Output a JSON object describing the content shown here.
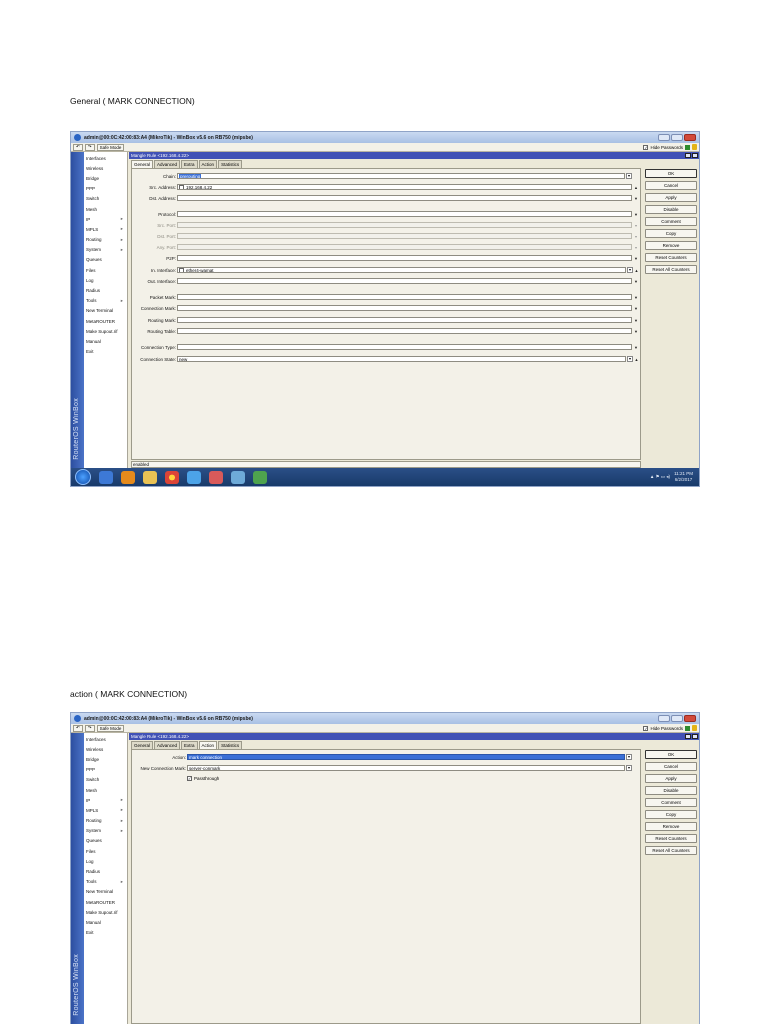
{
  "captions": {
    "first": "General ( MARK CONNECTION)",
    "second": "action ( MARK CONNECTION)"
  },
  "window": {
    "title": "admin@00:0C:42:00:83:A4 (MikroTik) - WinBox v5.6 on RB750 (mipsbe)",
    "safe_mode": "Safe Mode",
    "hide_passwords": "Hide Passwords",
    "side_label": "RouterOS WinBox"
  },
  "menu": [
    "Interfaces",
    "Wireless",
    "Bridge",
    "PPP",
    "Switch",
    "Mesh",
    "IP",
    "MPLS",
    "Routing",
    "System",
    "Queues",
    "Files",
    "Log",
    "Radius",
    "Tools",
    "New Terminal",
    "MetaROUTER",
    "Make Supout.rif",
    "Manual",
    "Exit"
  ],
  "menu_arrow": "▸",
  "dialog": {
    "title": "Mangle Rule <192.168.4.22>",
    "tabs": [
      "General",
      "Advanced",
      "Extra",
      "Action",
      "Statistics"
    ],
    "buttons": [
      "OK",
      "Cancel",
      "Apply",
      "Disable",
      "Comment",
      "Copy",
      "Remove",
      "Reset Counters",
      "Reset All Counters"
    ],
    "status": "enabled"
  },
  "general": {
    "chain_label": "Chain:",
    "chain_value": "prerouting",
    "src_label": "Src. Address:",
    "src_value": "192.168.4.22",
    "dst_label": "Dst. Address:",
    "protocol_label": "Protocol:",
    "src_port_label": "Src. Port:",
    "dst_port_label": "Dst. Port:",
    "any_port_label": "Any. Port:",
    "p2p_label": "P2P:",
    "in_iface_label": "In. Interface:",
    "in_iface_value": "ether4-wamat",
    "out_iface_label": "Out. Interface:",
    "packet_mark_label": "Packet Mark:",
    "conn_mark_label": "Connection Mark:",
    "routing_mark_label": "Routing Mark:",
    "routing_table_label": "Routing Table:",
    "conn_type_label": "Connection Type:",
    "conn_state_label": "Connection State:",
    "conn_state_value": "new"
  },
  "action": {
    "action_label": "Action:",
    "action_value": "mark connection",
    "new_mark_label": "New Connection Mark:",
    "new_mark_value": "server-conmark",
    "passthrough_label": "Passthrough",
    "passthrough_checked": true
  },
  "taskbar": {
    "time": "11:21 PM",
    "date": "6/2/2017"
  }
}
